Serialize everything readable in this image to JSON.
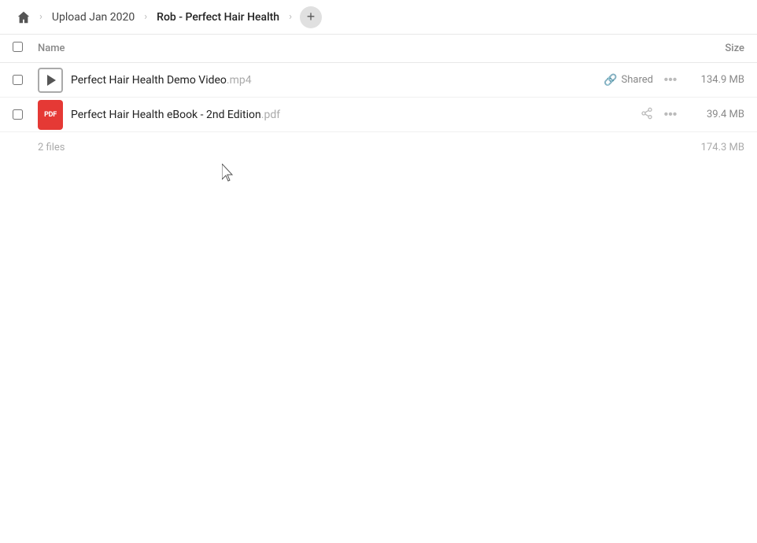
{
  "topbar": {
    "home_icon": "🏠",
    "breadcrumbs": [
      {
        "label": "Upload Jan 2020",
        "id": "upload-jan-2020"
      },
      {
        "label": "Rob - Perfect Hair Health",
        "id": "rob-perfect-hair-health"
      }
    ],
    "add_button_label": "+"
  },
  "table": {
    "col_name": "Name",
    "col_size": "Size"
  },
  "files": [
    {
      "id": "file-video",
      "name": "Perfect Hair Health Demo Video",
      "ext": ".mp4",
      "type": "video",
      "shared": true,
      "shared_label": "Shared",
      "size": "134.9 MB"
    },
    {
      "id": "file-pdf",
      "name": "Perfect Hair Health eBook - 2nd Edition",
      "ext": ".pdf",
      "type": "pdf",
      "shared": false,
      "shared_label": "",
      "size": "39.4 MB"
    }
  ],
  "footer": {
    "file_count": "2 files",
    "total_size": "174.3 MB"
  }
}
